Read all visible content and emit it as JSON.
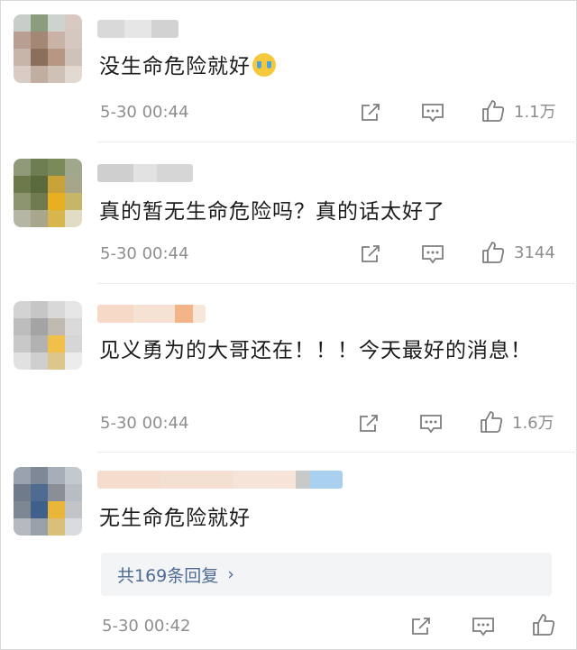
{
  "comments": [
    {
      "text": "没生命危险就好",
      "emoji": "crying-face",
      "time": "5-30 00:44",
      "like_count": "1.1万"
    },
    {
      "text": "真的暂无生命危险吗？真的话太好了",
      "time": "5-30 00:44",
      "like_count": "3144"
    },
    {
      "text": "见义勇为的大哥还在！！！今天最好的消息！",
      "time": "5-30 00:44",
      "like_count": "1.6万"
    },
    {
      "text": "无生命危险就好",
      "time": "5-30 00:42",
      "like_count": "",
      "replies_label": "共169条回复",
      "replies_chevron": "›"
    }
  ],
  "icons": {
    "repost": "repost-icon",
    "comment": "comment-icon",
    "like": "thumbs-up-icon"
  },
  "colors": {
    "text": "#1c1c1c",
    "meta": "#8e8e8e",
    "reply_link": "#4f6b95",
    "reply_bg": "#f3f4f6"
  }
}
